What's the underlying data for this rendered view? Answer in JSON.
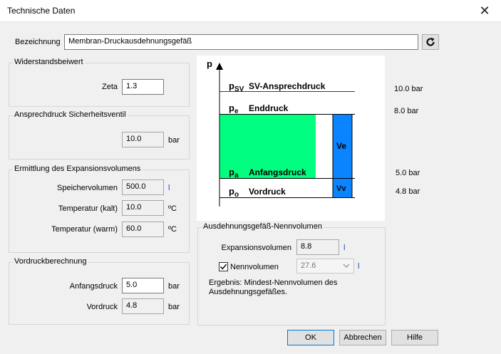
{
  "window": {
    "title": "Technische Daten",
    "close_symbol": "✕"
  },
  "designation": {
    "label": "Bezeichnung",
    "value": "Membran-Druckausdehnungsgefäß"
  },
  "resistance": {
    "group_title": "Widerstandsbeiwert",
    "zeta_label": "Zeta",
    "zeta_value": "1.3"
  },
  "safety_valve": {
    "group_title": "Ansprechdruck Sicherheitsventil",
    "value": "10.0",
    "unit": "bar"
  },
  "expansion": {
    "group_title": "Ermittlung des Expansionsvolumens",
    "rows": [
      {
        "label": "Speichervolumen",
        "value": "500.0",
        "unit": "l"
      },
      {
        "label": "Temperatur (kalt)",
        "value": "10.0",
        "unit": "ºC"
      },
      {
        "label": "Temperatur (warm)",
        "value": "60.0",
        "unit": "ºC"
      }
    ]
  },
  "prepressure": {
    "group_title": "Vordruckberechnung",
    "rows": [
      {
        "label": "Anfangsdruck",
        "value": "5.0",
        "unit": "bar"
      },
      {
        "label": "Vordruck",
        "value": "4.8",
        "unit": "bar"
      }
    ]
  },
  "diagram": {
    "axis_label": "p",
    "levels": [
      {
        "symbol": "p",
        "sub": "SV",
        "name": "SV-Ansprechdruck",
        "value": "10.0 bar"
      },
      {
        "symbol": "p",
        "sub": "e",
        "name": "Enddruck",
        "value": "8.0 bar"
      },
      {
        "symbol": "p",
        "sub": "a",
        "name": "Anfangsdruck",
        "value": "5.0 bar"
      },
      {
        "symbol": "p",
        "sub": "o",
        "name": "Vordruck",
        "value": "4.8 bar"
      }
    ],
    "ve_label": "Ve",
    "vv_label": "Vv",
    "colors": {
      "fill_green": "#00ff80",
      "fill_blue": "#0a84ff",
      "sv_line": "#cc0000"
    }
  },
  "nominal": {
    "group_title": "Ausdehnungsgefäß-Nennvolumen",
    "expansion_label": "Expansionsvolumen",
    "expansion_value": "8.8",
    "expansion_unit": "l",
    "nominal_label": "Nennvolumen",
    "nominal_checked": true,
    "nominal_value": "27.6",
    "nominal_unit": "l",
    "result_text": "Ergebnis: Mindest-Nennvolumen des Ausdehnungsgefäßes."
  },
  "buttons": {
    "ok": "OK",
    "cancel": "Abbrechen",
    "help": "Hilfe"
  }
}
